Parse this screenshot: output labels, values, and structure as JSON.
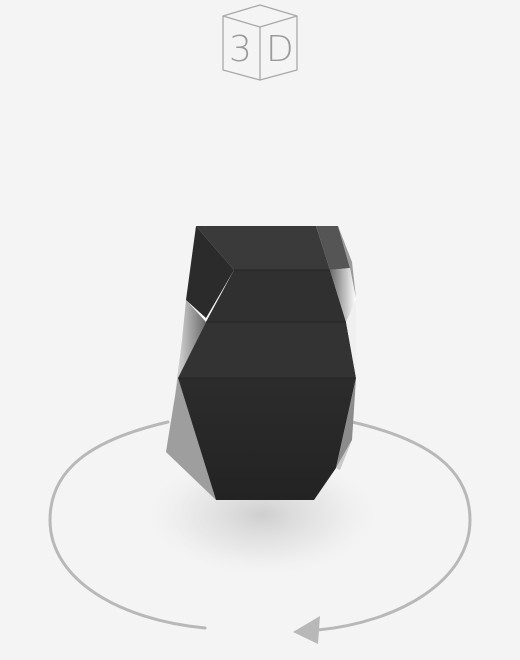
{
  "badge": {
    "char_1": "3",
    "char_2": "D",
    "icon": "cube-icon"
  },
  "controls": {
    "rotate_icon": "rotate-arrow-icon"
  },
  "colors": {
    "background": "#f4f4f4",
    "model_dark": "#2a2a2a",
    "arrow": "#b8b8b8",
    "badge_stroke": "#a9a9a9"
  }
}
